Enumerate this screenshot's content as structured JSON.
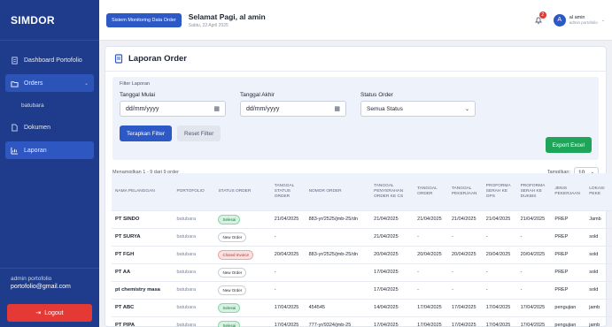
{
  "sidebar": {
    "brand": "SIMDOR",
    "items": [
      {
        "label": "Dashboard Portofolio"
      },
      {
        "label": "Orders"
      },
      {
        "label": "Dokumen"
      },
      {
        "label": "Laporan"
      }
    ],
    "sub_item": "batubara",
    "user_name": "admin portofolio",
    "user_email": "portofolio@gmail.com",
    "logout_label": "Logout"
  },
  "topbar": {
    "app_badge": "Sistem Monitoring Data Order",
    "greeting": "Selamat Pagi, al amin",
    "date": "Sabtu, 22 April 2025",
    "notif_count": "2",
    "avatar_initial": "A",
    "user_name": "al amin",
    "user_role": "admin portofolio"
  },
  "page": {
    "title": "Laporan Order"
  },
  "filter": {
    "section_label": "Filter Laporan",
    "start_label": "Tanggal Mulai",
    "start_value": "dd/mm/yyyy",
    "end_label": "Tanggal Akhir",
    "end_value": "dd/mm/yyyy",
    "status_label": "Status Order",
    "status_value": "Semua Status",
    "apply_label": "Terapkan Filter",
    "reset_label": "Reset Filter",
    "export_label": "Export Excel"
  },
  "table_meta": {
    "info": "Menampilkan 1 - 9 dari 9 order",
    "per_page_label": "Tampilkan:",
    "per_page_value": "10"
  },
  "table": {
    "headers": [
      "NAMA PELANGGAN",
      "PORTOFOLIO",
      "STATUS ORDER",
      "TANGGAL STATUS ORDER",
      "NOMOR ORDER",
      "TANGGAL PENYERAHAN ORDER KE CS",
      "TANGGAL ORDER",
      "TANGGAL PEKERJAAN",
      "PROFORMA SERAH KE OPS",
      "PROFORMA SERAH KE DUKBIS",
      "JENIS PEKERJAAN",
      "LOKASI PEKE"
    ],
    "rows": [
      {
        "c": [
          "PT SINDO",
          "batubara",
          "Selesai",
          "21/04/2025",
          "883-yr/2525/jmb-25/dn",
          "21/04/2025",
          "21/04/2025",
          "21/04/2025",
          "21/04/2025",
          "21/04/2025",
          "PREP",
          "Jamb"
        ],
        "badge": "green"
      },
      {
        "c": [
          "PT SURYA",
          "batubara",
          "New Order",
          "-",
          "",
          "21/04/2025",
          "-",
          "-",
          "-",
          "-",
          "PREP",
          "sold"
        ],
        "badge": "plain"
      },
      {
        "c": [
          "PT FGH",
          "batubara",
          "Closed Invoice",
          "20/04/2025",
          "883-yr/2525/jmb-25/dn",
          "20/04/2025",
          "20/04/2025",
          "20/04/2025",
          "20/04/2025",
          "20/04/2025",
          "PREP",
          "sold"
        ],
        "badge": "red"
      },
      {
        "c": [
          "PT AA",
          "batubara",
          "New Order",
          "-",
          "",
          "17/04/2025",
          "-",
          "-",
          "-",
          "-",
          "PREP",
          "sold"
        ],
        "badge": "plain"
      },
      {
        "c": [
          "pt chemistry masa",
          "batubara",
          "New Order",
          "-",
          "",
          "17/04/2025",
          "-",
          "-",
          "-",
          "-",
          "PREP",
          "sold"
        ],
        "badge": "plain"
      },
      {
        "c": [
          "PT ABC",
          "batubara",
          "Selesai",
          "17/04/2025",
          "454545",
          "14/04/2025",
          "17/04/2025",
          "17/04/2025",
          "17/04/2025",
          "17/04/2025",
          "pengujian",
          "jamb"
        ],
        "badge": "green"
      },
      {
        "c": [
          "PT PIPA",
          "batubara",
          "Selesai",
          "17/04/2025",
          "777-yr/9324/jmb-25",
          "17/04/2025",
          "17/04/2025",
          "17/04/2025",
          "17/04/2025",
          "17/04/2025",
          "pengujian",
          "jamb"
        ],
        "badge": "green"
      }
    ]
  }
}
